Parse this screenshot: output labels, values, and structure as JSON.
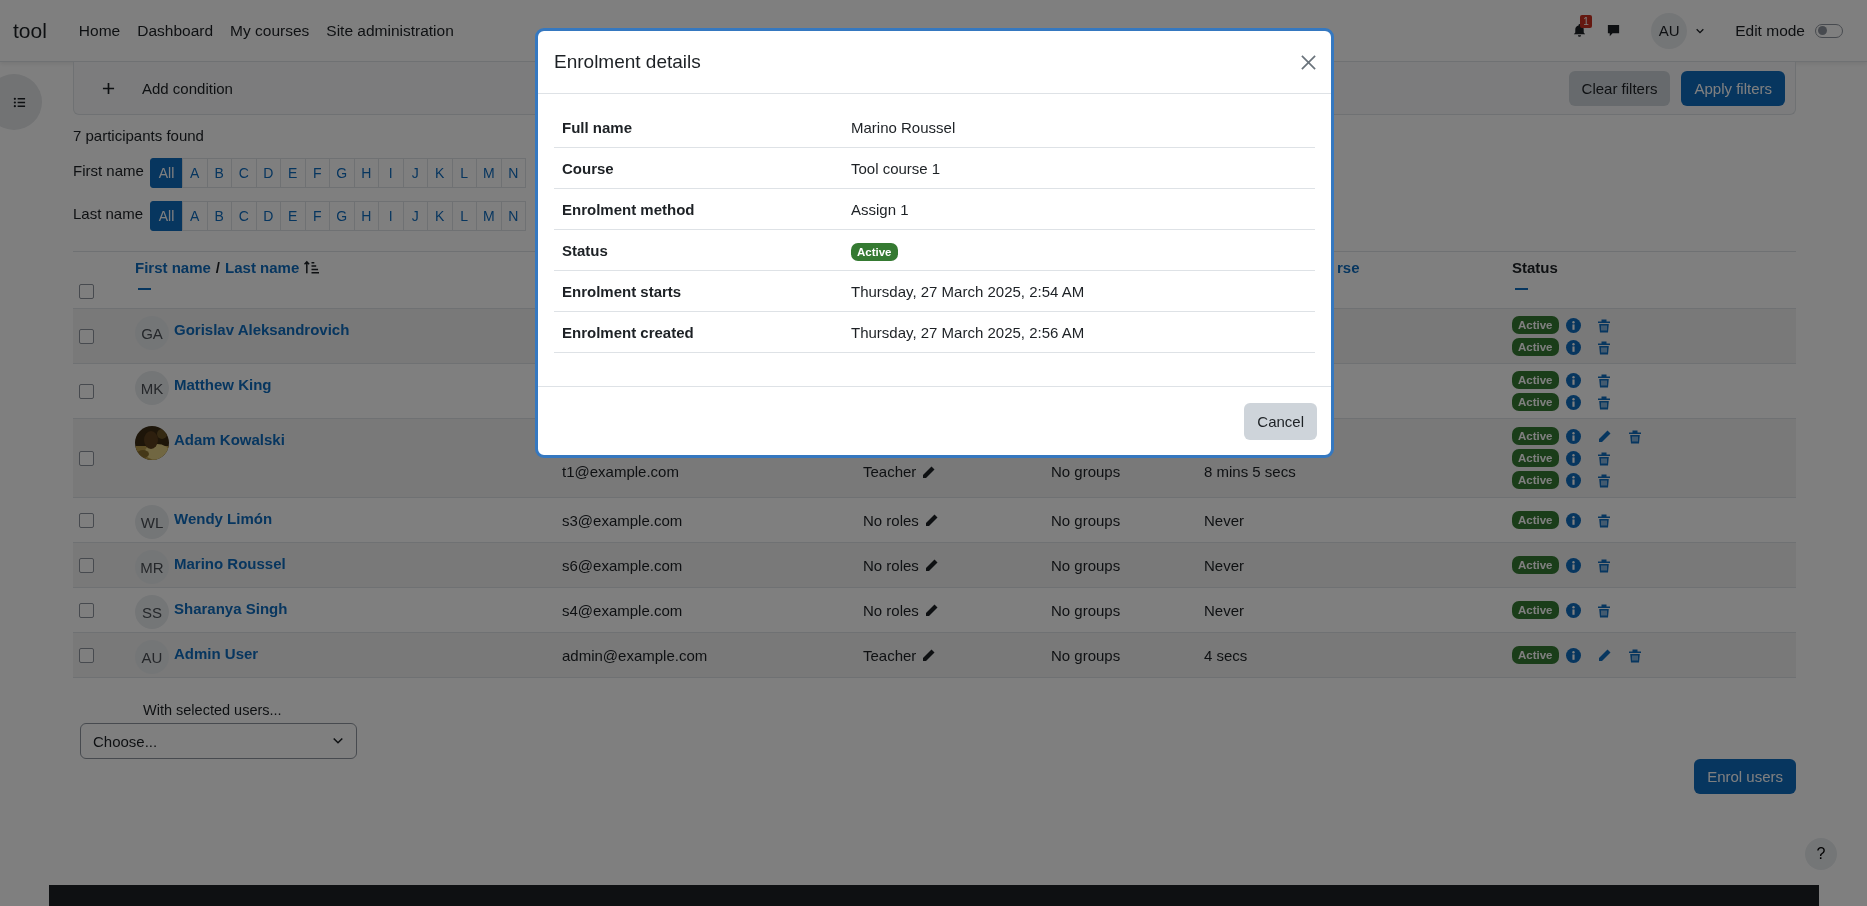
{
  "navbar": {
    "brand": "tool",
    "links": [
      "Home",
      "Dashboard",
      "My courses",
      "Site administration"
    ],
    "notification_count": "1",
    "avatar": "AU",
    "edit_mode": {
      "label": "Edit mode",
      "on": false
    }
  },
  "filter_bar": {
    "add_label": "Add condition",
    "buttons": [
      {
        "label": "Clear filters",
        "kind": "secondary"
      },
      {
        "label": "Apply filters",
        "kind": "primary"
      }
    ]
  },
  "participants_found": "7 participants found",
  "initials_bars": [
    {
      "label": "First name",
      "letters": [
        {
          "text": "All",
          "selected": true
        },
        {
          "text": "A",
          "selected": false
        },
        {
          "text": "B",
          "selected": false
        },
        {
          "text": "C",
          "selected": false
        },
        {
          "text": "D",
          "selected": false
        },
        {
          "text": "E",
          "selected": false
        },
        {
          "text": "F",
          "selected": false
        },
        {
          "text": "G",
          "selected": false
        },
        {
          "text": "H",
          "selected": false
        },
        {
          "text": "I",
          "selected": false
        },
        {
          "text": "J",
          "selected": false
        },
        {
          "text": "K",
          "selected": false
        },
        {
          "text": "L",
          "selected": false
        },
        {
          "text": "M",
          "selected": false
        },
        {
          "text": "N",
          "selected": false
        }
      ]
    },
    {
      "label": "Last name",
      "letters": [
        {
          "text": "All",
          "selected": true
        },
        {
          "text": "A",
          "selected": false
        },
        {
          "text": "B",
          "selected": false
        },
        {
          "text": "C",
          "selected": false
        },
        {
          "text": "D",
          "selected": false
        },
        {
          "text": "E",
          "selected": false
        },
        {
          "text": "F",
          "selected": false
        },
        {
          "text": "G",
          "selected": false
        },
        {
          "text": "H",
          "selected": false
        },
        {
          "text": "I",
          "selected": false
        },
        {
          "text": "J",
          "selected": false
        },
        {
          "text": "K",
          "selected": false
        },
        {
          "text": "L",
          "selected": false
        },
        {
          "text": "M",
          "selected": false
        },
        {
          "text": "N",
          "selected": false
        }
      ]
    }
  ],
  "table": {
    "select_all": false,
    "name_header": {
      "links": [
        "First name",
        "Last name"
      ],
      "separator": "/",
      "sort_ascending": true
    },
    "column_5": "rse",
    "status_header": "Status",
    "rows": [
      {
        "selected": false,
        "avatar": {
          "kind": "initials",
          "text": "GA"
        },
        "name": "Gorislav Aleksandrovich",
        "enrolments": [
          {
            "status": "Active",
            "editable": false
          },
          {
            "status": "Active",
            "editable": false
          }
        ]
      },
      {
        "selected": false,
        "avatar": {
          "kind": "initials",
          "text": "MK"
        },
        "name": "Matthew King",
        "enrolments": [
          {
            "status": "Active",
            "editable": false
          },
          {
            "status": "Active",
            "editable": false
          }
        ]
      },
      {
        "selected": false,
        "avatar": {
          "kind": "picture"
        },
        "name": "Adam Kowalski",
        "email": "t1@example.com",
        "roles": "Teacher",
        "groups": "No groups",
        "last_access": "8 mins 5 secs",
        "enrolments": [
          {
            "status": "Active",
            "editable": true
          },
          {
            "status": "Active",
            "editable": false
          },
          {
            "status": "Active",
            "editable": false
          }
        ]
      },
      {
        "selected": false,
        "avatar": {
          "kind": "initials",
          "text": "WL"
        },
        "name": "Wendy Limón",
        "email": "s3@example.com",
        "roles": "No roles",
        "groups": "No groups",
        "last_access": "Never",
        "enrolments": [
          {
            "status": "Active",
            "editable": false
          }
        ]
      },
      {
        "selected": false,
        "avatar": {
          "kind": "initials",
          "text": "MR"
        },
        "name": "Marino Roussel",
        "email": "s6@example.com",
        "roles": "No roles",
        "groups": "No groups",
        "last_access": "Never",
        "enrolments": [
          {
            "status": "Active",
            "editable": false
          }
        ]
      },
      {
        "selected": false,
        "avatar": {
          "kind": "initials",
          "text": "SS"
        },
        "name": "Sharanya Singh",
        "email": "s4@example.com",
        "roles": "No roles",
        "groups": "No groups",
        "last_access": "Never",
        "enrolments": [
          {
            "status": "Active",
            "editable": false
          }
        ]
      },
      {
        "selected": false,
        "avatar": {
          "kind": "initials",
          "text": "AU"
        },
        "name": "Admin User",
        "email": "admin@example.com",
        "roles": "Teacher",
        "groups": "No groups",
        "last_access": "4 secs",
        "enrolments": [
          {
            "status": "Active",
            "editable": true
          }
        ]
      }
    ]
  },
  "bulk_actions": {
    "label": "With selected users...",
    "select_value": "Choose..."
  },
  "enrol_button": "Enrol users",
  "help_button": "?",
  "modal": {
    "title": "Enrolment details",
    "rows": [
      {
        "label": "Full name",
        "value": "Marino Roussel",
        "kind": "text"
      },
      {
        "label": "Course",
        "value": "Tool course 1",
        "kind": "text"
      },
      {
        "label": "Enrolment method",
        "value": "Assign 1",
        "kind": "text"
      },
      {
        "label": "Status",
        "value": "Active",
        "kind": "badge"
      },
      {
        "label": "Enrolment starts",
        "value": "Thursday, 27 March 2025, 2:54 AM",
        "kind": "text"
      },
      {
        "label": "Enrolment created",
        "value": "Thursday, 27 March 2025, 2:56 AM",
        "kind": "text"
      }
    ],
    "buttons": [
      "Cancel"
    ]
  }
}
